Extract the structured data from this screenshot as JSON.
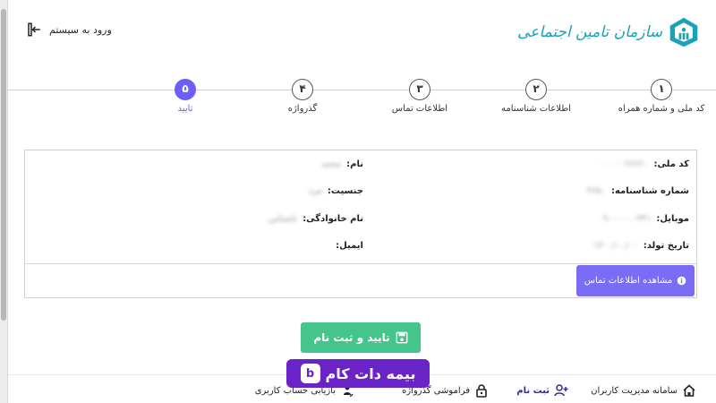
{
  "header": {
    "login_label": "ورود به سیستم",
    "logo_text": "سازمان تامین اجتماعی"
  },
  "stepper": {
    "steps": [
      {
        "number": "١",
        "label": "کد ملی و شماره همراه"
      },
      {
        "number": "٢",
        "label": "اطلاعات شناسنامه"
      },
      {
        "number": "٣",
        "label": "اطلاعات تماس"
      },
      {
        "number": "۴",
        "label": "گذرواژه"
      },
      {
        "number": "۵",
        "label": "تایید"
      }
    ],
    "active_step": 5
  },
  "details": {
    "national_code": {
      "label": "کد ملی:",
      "value": "۰۰۰۰۰۶۶۶۶۰"
    },
    "id_number": {
      "label": "شماره شناسنامه:",
      "value": "۳۶۵۰"
    },
    "mobile": {
      "label": "موبایل:",
      "value": "۰۹۰۰۰۰۰۰۳۴۱"
    },
    "birth_date": {
      "label": "تاریخ تولد:",
      "value": "۱۳۰۰/۰۰/۰۰"
    },
    "first_name": {
      "label": "نام:",
      "value": "محمد"
    },
    "gender": {
      "label": "جنسیت:",
      "value": "مرد"
    },
    "last_name": {
      "label": "نام خانوادگی:",
      "value": "ناشناس"
    },
    "email": {
      "label": "ایمیل:",
      "value": ""
    }
  },
  "contact_button_label": "مشاهده اطلاعات تماس",
  "confirm_button_label": "تایید و ثبت نام",
  "footer": {
    "user_management": "سامانه مدیریت کاربران",
    "register": "ثبت نام",
    "forgot_password": "فراموشی گذرواژه",
    "recover_account": "بازیابی حساب کاربری"
  },
  "watermark_text": "بیمه دات کام",
  "colors": {
    "accent": "#6d5ef5",
    "confirm": "#45c48b",
    "brand": "#1aa3b8",
    "watermark": "#6a23c7"
  }
}
